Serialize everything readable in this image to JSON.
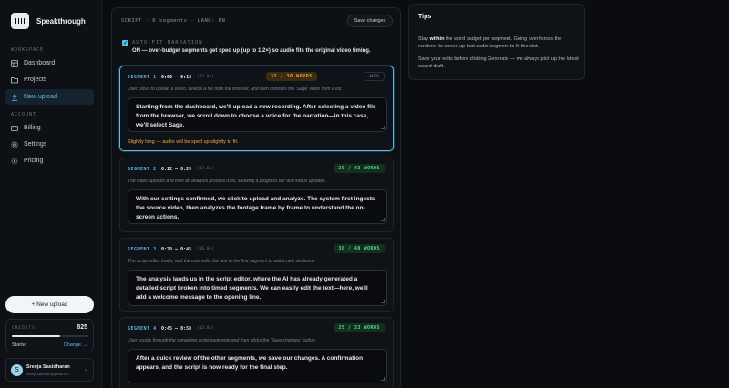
{
  "app": {
    "name": "Speakthrough"
  },
  "sidebar": {
    "workspace_label": "WORKSPACE",
    "account_label": "ACCOUNT",
    "workspace_items": [
      {
        "label": "Dashboard",
        "icon": "grid-icon"
      },
      {
        "label": "Projects",
        "icon": "folder-icon"
      },
      {
        "label": "New upload",
        "icon": "upload-icon",
        "active": true
      }
    ],
    "account_items": [
      {
        "label": "Billing",
        "icon": "card-icon"
      },
      {
        "label": "Settings",
        "icon": "gear-icon"
      },
      {
        "label": "Pricing",
        "icon": "tag-icon"
      }
    ],
    "new_upload_button": "+ New upload",
    "credits": {
      "label": "CREDITS",
      "value": "825",
      "fill_fraction": 0.62,
      "plan": "Starter",
      "change_link": "Change →"
    },
    "user": {
      "initial": "S",
      "name": "Sreeja Sasidharan",
      "email": "sreeja.sabhijith@gmail.co..."
    }
  },
  "main": {
    "script_meta": "SCRIPT · 6 segments · LANG: EN",
    "save_button": "Save changes",
    "autofit": {
      "checked": true,
      "title": "AUTO-FIT NARRATION",
      "description": "ON — over-budget segments get sped up (up to 1.2×) so audio fits the original video timing."
    },
    "segments": [
      {
        "label": "SEGMENT 1",
        "time": "0:00 – 0:12",
        "duration": "(12.8s)",
        "words": "32 / 30 WORDS",
        "status": "warn",
        "auto_badge": "AUTO",
        "description": "User clicks to upload a video, selects a file from the browser, and then chooses the 'Sage' voice from a list.",
        "text": "Starting from the dashboard, we'll upload a new recording. After selecting a video file from the browser, we scroll down to choose a voice for the narration—in this case, we'll select Sage.",
        "warning": "Slightly long — audio will be sped up slightly to fit."
      },
      {
        "label": "SEGMENT 2",
        "time": "0:12 – 0:29",
        "duration": "(17.0s)",
        "words": "29 / 43 WORDS",
        "status": "ok",
        "description": "The video uploads and then an analysis process runs, showing a progress bar and status updates.",
        "text": "With our settings confirmed, we click to upload and analyze. The system first ingests the source video, then analyzes the footage frame by frame to understand the on-screen actions."
      },
      {
        "label": "SEGMENT 3",
        "time": "0:29 – 0:45",
        "duration": "(16.0s)",
        "words": "36 / 40 WORDS",
        "status": "ok",
        "description": "The script editor loads, and the user edits the text in the first segment to add a new sentence.",
        "text": "The analysis lands us in the script editor, where the AI has already generated a detailed script broken into timed segments. We can easily edit the text—here, we'll add a welcome message to the opening line."
      },
      {
        "label": "SEGMENT 4",
        "time": "0:45 – 0:58",
        "duration": "(13.0s)",
        "words": "25 / 33 WORDS",
        "status": "ok",
        "description": "User scrolls through the remaining script segments and then clicks the 'Save changes' button.",
        "text": "After a quick review of the other segments, we save our changes. A confirmation appears, and the script is now ready for the final step."
      }
    ]
  },
  "tips": {
    "title": "Tips",
    "line1_pre": "Stay ",
    "line1_bold": "within",
    "line1_post": " the word budget per segment. Going over forces the renderer to speed up that audio segment to fit the slot.",
    "line2": "Save your edits before clicking Generate — we always pick up the latest saved draft."
  }
}
